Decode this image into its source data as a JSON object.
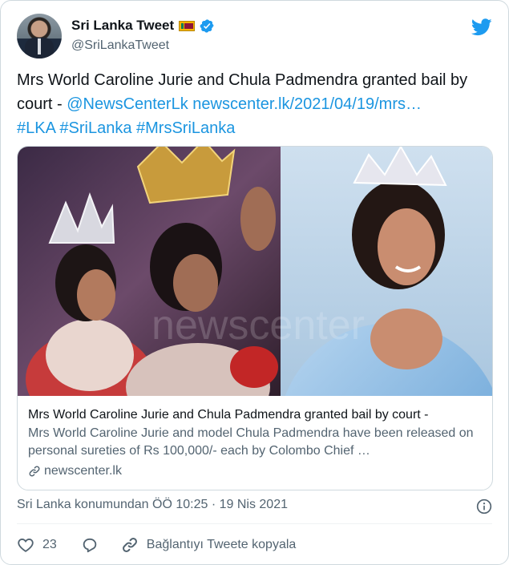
{
  "user": {
    "display_name": "Sri Lanka Tweet",
    "handle": "@SriLankaTweet",
    "flag": "sri-lanka-flag",
    "verified": true
  },
  "tweet": {
    "text_plain": "Mrs World Caroline Jurie and Chula Padmendra granted bail by court - ",
    "mention": "@NewsCenterLk",
    "url": "newscenter.lk/2021/04/19/mrs…",
    "hashtags": [
      "#LKA",
      "#SriLanka",
      "#MrsSriLanka"
    ]
  },
  "card": {
    "watermark": "newscenter",
    "title": "Mrs World Caroline Jurie and Chula Padmendra granted bail by court -",
    "description": "Mrs World Caroline Jurie and model Chula Padmendra have been released on personal sureties of Rs 100,000/- each by Colombo Chief …",
    "site": "newscenter.lk"
  },
  "meta": {
    "source": "Sri Lanka konumundan ÖÖ 10:25 · 19 Nis 2021"
  },
  "actions": {
    "likes": "23",
    "copy_link": "Bağlantıyı Tweete kopyala"
  },
  "colors": {
    "link": "#1b95e0",
    "secondary_text": "#536471",
    "border": "#cfd9de",
    "verified": "#1d9bf0",
    "twitter_blue": "#1d9bf0"
  },
  "icons": [
    "twitter-bird-icon",
    "verified-badge-icon",
    "link-icon",
    "info-icon",
    "heart-icon",
    "reply-icon",
    "copy-link-icon"
  ]
}
